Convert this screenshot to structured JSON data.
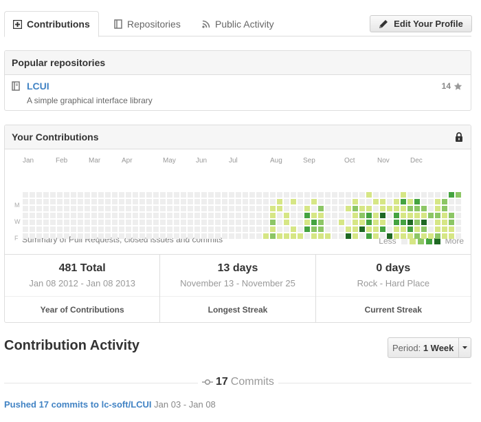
{
  "tabs": [
    {
      "label": "Contributions",
      "icon": "plus-square-icon",
      "active": true
    },
    {
      "label": "Repositories",
      "icon": "book-icon",
      "active": false
    },
    {
      "label": "Public Activity",
      "icon": "rss-icon",
      "active": false
    }
  ],
  "edit_profile": {
    "label": "Edit Your Profile",
    "icon": "pencil-icon"
  },
  "popular": {
    "title": "Popular repositories",
    "repos": [
      {
        "name": "LCUI",
        "description": "A simple graphical interface library",
        "stars": "14"
      }
    ]
  },
  "contributions": {
    "title": "Your Contributions",
    "months": [
      "Jan",
      "Feb",
      "Mar",
      "Apr",
      "May",
      "Jun",
      "Jul",
      "Aug",
      "Sep",
      "Oct",
      "Nov",
      "Dec"
    ],
    "day_labels": [
      "M",
      "W",
      "F"
    ],
    "summary": "Summary of Pull Requests, closed issues and commits",
    "legend_less": "Less",
    "legend_more": "More",
    "colors": [
      "#eeeeee",
      "#d6e685",
      "#8cc665",
      "#44a340",
      "#1e6823"
    ],
    "weeks_levels": [
      "0000000",
      "0000000",
      "0000000",
      "0000000",
      "0000000",
      "0000000",
      "0000000",
      "0000000",
      "0000000",
      "0000000",
      "0000000",
      "0000000",
      "0000000",
      "0000000",
      "0000000",
      "0000000",
      "0000000",
      "0000000",
      "0000000",
      "0000000",
      "0000000",
      "0000000",
      "0000000",
      "0000000",
      "0000000",
      "0000000",
      "0000000",
      "0000000",
      "0000000",
      "0000000",
      "0000000",
      "0000000",
      "0000000",
      "0000000",
      "0000000",
      "0000001",
      "0011212",
      "0110001",
      "0001101",
      "0100011",
      "0000001",
      "0013130",
      "0101321",
      "0021221",
      "0000001",
      "0000000",
      "0000100",
      "0010014",
      "0121111",
      "0012140",
      "1013313",
      "0101111",
      "0114130",
      "0010004",
      "0113311",
      "1311311",
      "0121431",
      "0321212",
      "0021421",
      "0002001",
      "0112112",
      "0221111",
      "3002211",
      "2000000"
    ],
    "stats": [
      {
        "big": "481 Total",
        "range": "Jan 08 2012 - Jan 08 2013",
        "label": "Year of Contributions"
      },
      {
        "big": "13 days",
        "range": "November 13 - November 25",
        "label": "Longest Streak"
      },
      {
        "big": "0 days",
        "range": "Rock - Hard Place",
        "label": "Current Streak"
      }
    ]
  },
  "activity": {
    "title": "Contribution Activity",
    "period_prefix": "Period:",
    "period_value": "1 Week",
    "commit_count": "17",
    "commits_word": "Commits",
    "pushed_link": "Pushed 17 commits to lc-soft/LCUI",
    "pushed_dates": "Jan 03 - Jan 08"
  }
}
